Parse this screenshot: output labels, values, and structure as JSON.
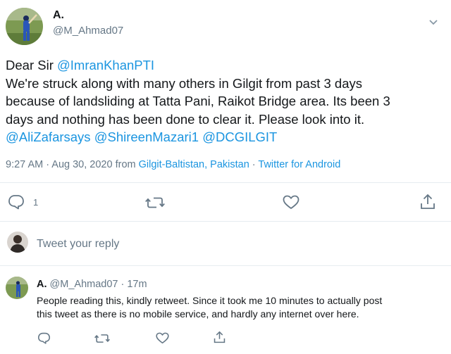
{
  "tweet": {
    "author": {
      "display_name": "A.",
      "handle": "@M_Ahmad07",
      "avatar_icon": "cricket-player-avatar"
    },
    "text_lines": [
      [
        {
          "t": "Dear Sir "
        },
        {
          "t": "@ImranKhanPTI",
          "mention": true
        }
      ],
      [
        {
          "t": "We're struck along with many others in Gilgit from past 3 days"
        }
      ],
      [
        {
          "t": "because of landsliding at Tatta Pani, Raikot Bridge area. Its been 3"
        }
      ],
      [
        {
          "t": "days and nothing has been done to clear it. Please look into it."
        }
      ],
      [
        {
          "t": "@AliZafarsays",
          "mention": true
        },
        {
          "t": " "
        },
        {
          "t": "@ShireenMazari1",
          "mention": true
        },
        {
          "t": " "
        },
        {
          "t": "@DCGILGIT",
          "mention": true
        }
      ]
    ],
    "time": "9:27 AM · Aug 30, 2020 from ",
    "location": "Gilgit-Baltistan, Pakistan",
    "separator": " · ",
    "source": "Twitter for Android",
    "reply_count": "1"
  },
  "reply_box": {
    "placeholder": "Tweet your reply",
    "avatar_icon": "user-avatar"
  },
  "reply": {
    "display_name": "A.",
    "handle": "@M_Ahmad07",
    "dot": " · ",
    "age": "17m",
    "text_lines": [
      "People reading this, kindly retweet. Since it took me 10 minutes to actually post",
      "this tweet as there is no mobile service, and hardly any internet over here."
    ]
  },
  "colors": {
    "link": "#1b95e0",
    "secondary": "#657786",
    "divider": "#e6ecf0",
    "text": "#14171a"
  }
}
